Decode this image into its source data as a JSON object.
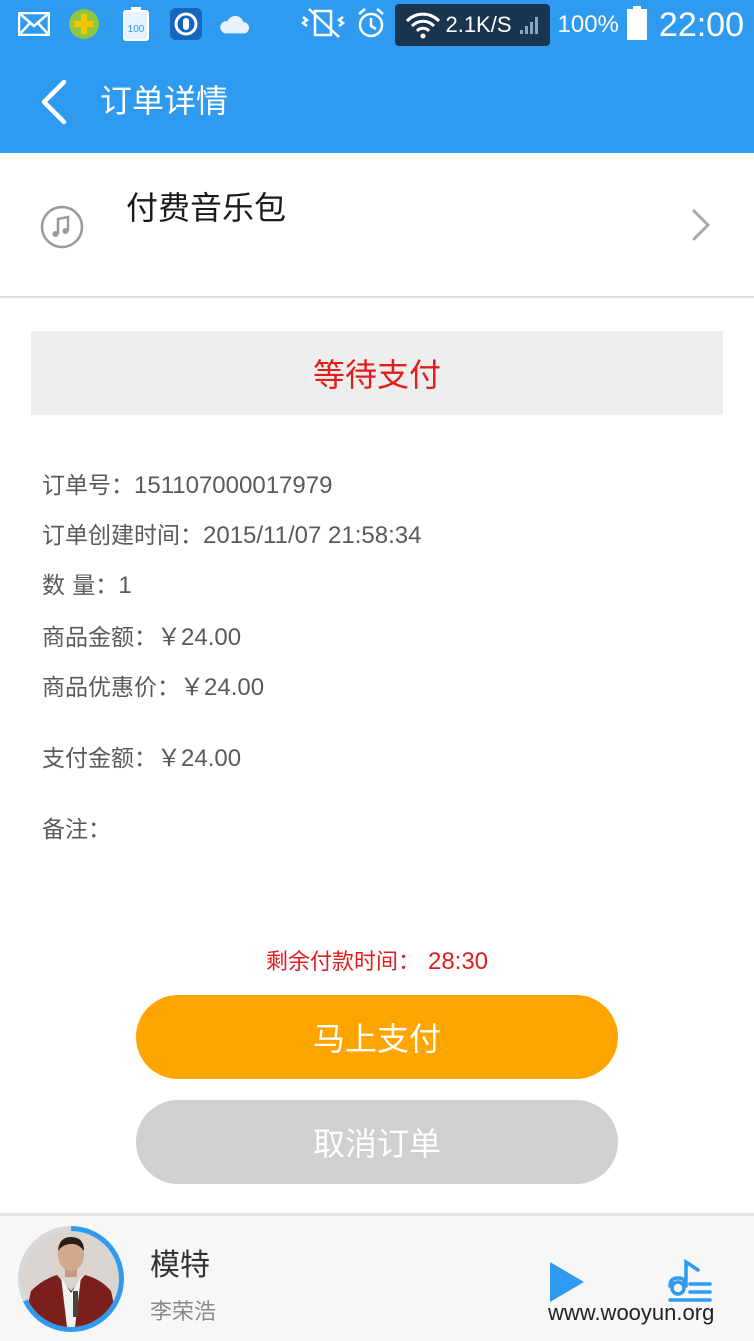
{
  "status_bar": {
    "battery_badge": "100",
    "network_speed": "2.1K/S",
    "battery_percent": "100%",
    "time": "22:00"
  },
  "header": {
    "title": "订单详情",
    "accent_color": "#2f9bf0"
  },
  "product": {
    "name": "付费音乐包",
    "icon": "music-note-icon"
  },
  "order": {
    "status": "等待支付",
    "number_label": "订单号：",
    "number": "151107000017979",
    "created_label": "订单创建时间：",
    "created": "2015/11/07 21:58:34",
    "quantity_label": "数 量：",
    "quantity": "1",
    "amount_label": "商品金额：",
    "amount": "￥24.00",
    "discount_label": "商品优惠价：",
    "discount": "￥24.00",
    "pay_amount_label": "支付金额：",
    "pay_amount": "￥24.00",
    "remark_label": "备注：",
    "remark": ""
  },
  "countdown": {
    "label": "剩余付款时间：",
    "value": "28:30"
  },
  "actions": {
    "pay_label": "马上支付",
    "cancel_label": "取消订单",
    "pay_color": "#ffa500",
    "cancel_color": "#d0d0d0"
  },
  "player": {
    "song": "模特",
    "artist": "李荣浩",
    "progress": 0.68
  },
  "watermark": "www.wooyun.org"
}
